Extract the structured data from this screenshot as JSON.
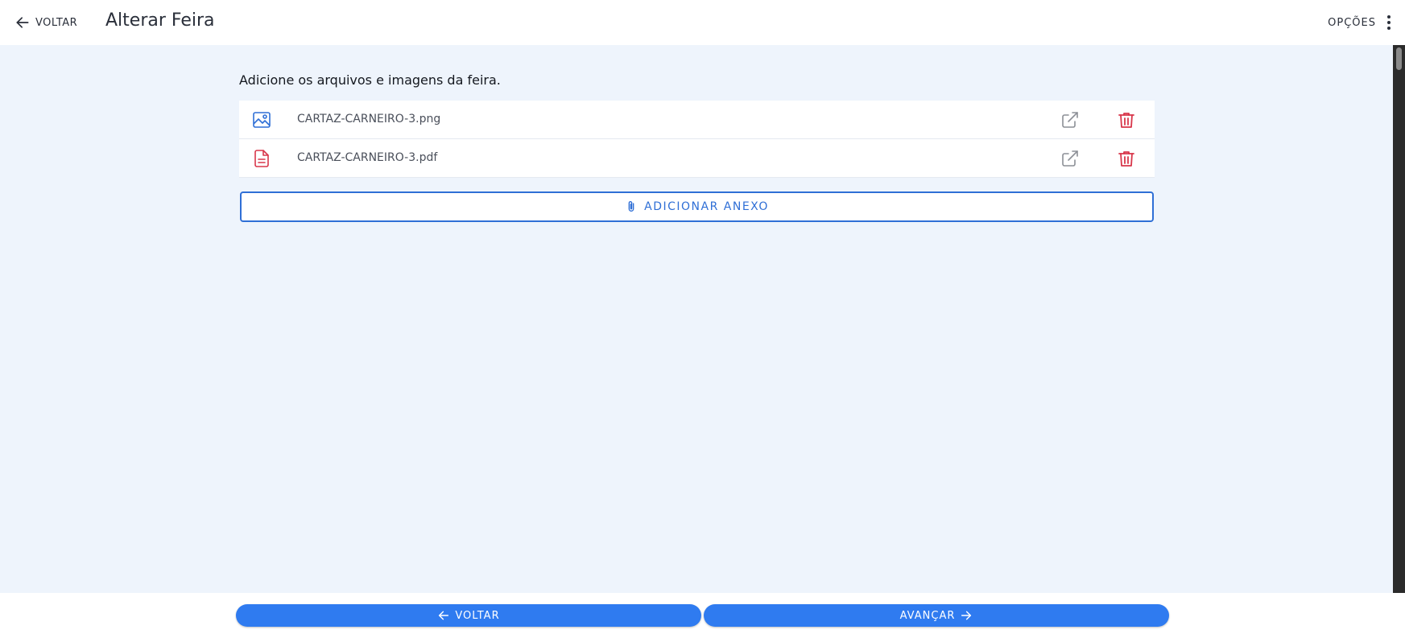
{
  "header": {
    "back_label": "VOLTAR",
    "title": "Alterar Feira",
    "options_label": "OPÇÕES"
  },
  "main": {
    "instructions": "Adicione os arquivos e imagens da feira.",
    "files": [
      {
        "name": "CARTAZ-CARNEIRO-3.png",
        "type_icon": "image-file-icon"
      },
      {
        "name": "CARTAZ-CARNEIRO-3.pdf",
        "type_icon": "document-file-icon"
      }
    ],
    "add_button_label": "ADICIONAR ANEXO"
  },
  "footer": {
    "back_label": "VOLTAR",
    "next_label": "AVANÇAR"
  },
  "colors": {
    "accent": "#2f7bf0",
    "outline_accent": "#2f6fd6",
    "danger": "#d8364a",
    "background": "#eef4fc"
  }
}
